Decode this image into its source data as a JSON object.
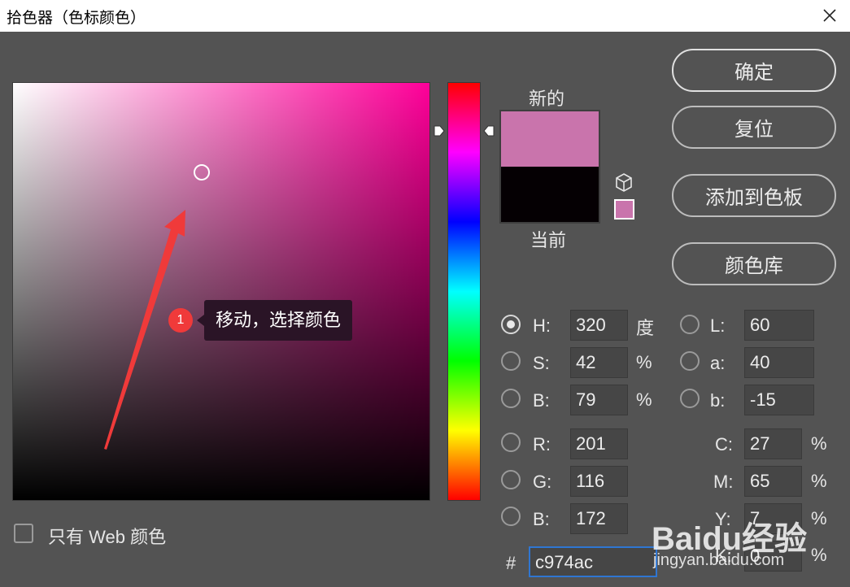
{
  "window": {
    "title": "拾色器（色标颜色）"
  },
  "colors": {
    "new": "#c974ac",
    "current": "#050003",
    "hue_base": "#ff0099",
    "accent": "#2f76d2",
    "callout": "#2a1426",
    "badge": "#f03a3a"
  },
  "swatch": {
    "new_label": "新的",
    "current_label": "当前"
  },
  "buttons": {
    "ok": "确定",
    "reset": "复位",
    "add_to_swatches": "添加到色板",
    "color_libraries": "颜色库"
  },
  "hsb": {
    "h": {
      "label": "H:",
      "value": "320",
      "unit": "度",
      "selected": true
    },
    "s": {
      "label": "S:",
      "value": "42",
      "unit": "%"
    },
    "b": {
      "label": "B:",
      "value": "79",
      "unit": "%"
    }
  },
  "lab": {
    "l": {
      "label": "L:",
      "value": "60"
    },
    "a": {
      "label": "a:",
      "value": "40"
    },
    "b": {
      "label": "b:",
      "value": "-15"
    }
  },
  "rgb": {
    "r": {
      "label": "R:",
      "value": "201"
    },
    "g": {
      "label": "G:",
      "value": "116"
    },
    "b": {
      "label": "B:",
      "value": "172"
    }
  },
  "cmyk": {
    "c": {
      "label": "C:",
      "value": "27",
      "unit": "%"
    },
    "m": {
      "label": "M:",
      "value": "65",
      "unit": "%"
    },
    "y": {
      "label": "Y:",
      "value": "7",
      "unit": "%"
    },
    "k": {
      "label": "K:",
      "value": "0",
      "unit": "%"
    }
  },
  "hex": {
    "label": "#",
    "value": "c974ac"
  },
  "web_only": {
    "label": "只有 Web 颜色",
    "checked": false
  },
  "annotation": {
    "step": "1",
    "text": "移动，选择颜色"
  },
  "watermark": {
    "brand": "Baidu经验",
    "site": "jingyan.baidu.com"
  }
}
